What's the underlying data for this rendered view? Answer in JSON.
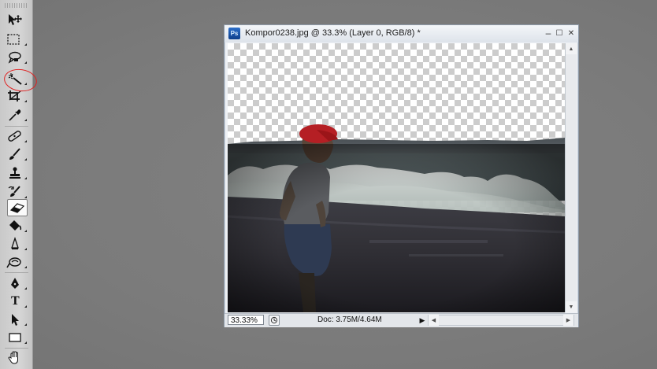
{
  "document": {
    "title": "Kompor0238.jpg @ 33.3% (Layer 0, RGB/8) *",
    "app_icon_label": "Ps",
    "window_controls": {
      "minimize": "‒",
      "maximize": "☐",
      "close": "✕"
    }
  },
  "status_bar": {
    "zoom": "33.33%",
    "doc_size": "Doc: 3.75M/4.64M",
    "menu_arrow": "▶"
  },
  "scrollbars": {
    "up_arrow": "▲",
    "down_arrow": "▼",
    "left_arrow": "◀",
    "right_arrow": "▶"
  },
  "toolbar": {
    "active_tool": "eraser",
    "type_tool_glyph": "T",
    "tools": [
      "move-icon",
      "marquee-icon",
      "lasso-icon",
      "magic-wand-icon",
      "crop-icon",
      "eyedropper-icon",
      "healing-brush-icon",
      "brush-icon",
      "clone-stamp-icon",
      "history-brush-icon",
      "eraser-icon",
      "paint-bucket-icon",
      "blur-icon",
      "dodge-icon",
      "pen-icon",
      "type-icon",
      "path-selection-icon",
      "rectangle-icon",
      "hand-icon"
    ]
  },
  "annotation_color": "#e02020"
}
